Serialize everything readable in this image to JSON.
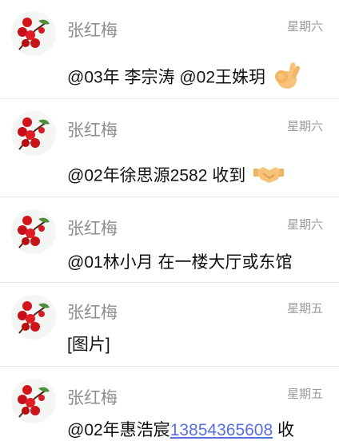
{
  "messages": [
    {
      "sender": "张红梅",
      "date": "星期六",
      "text": "@03年 李宗涛 @02王姝玥",
      "emoji": "ok-hand-icon"
    },
    {
      "sender": "张红梅",
      "date": "星期六",
      "text": "@02年徐思源2582 收到",
      "emoji": "handshake-icon"
    },
    {
      "sender": "张红梅",
      "date": "星期六",
      "text": "@01林小月 在一楼大厅或东馆"
    },
    {
      "sender": "张红梅",
      "date": "星期五",
      "text": "[图片]"
    },
    {
      "sender": "张红梅",
      "date": "星期五",
      "text_prefix": "@02年惠浩宸",
      "link": "13854365608",
      "text_suffix": " 收"
    }
  ],
  "colors": {
    "link": "#5a6ee3",
    "sender": "#8f8f8f",
    "date": "#9b9b9b"
  }
}
